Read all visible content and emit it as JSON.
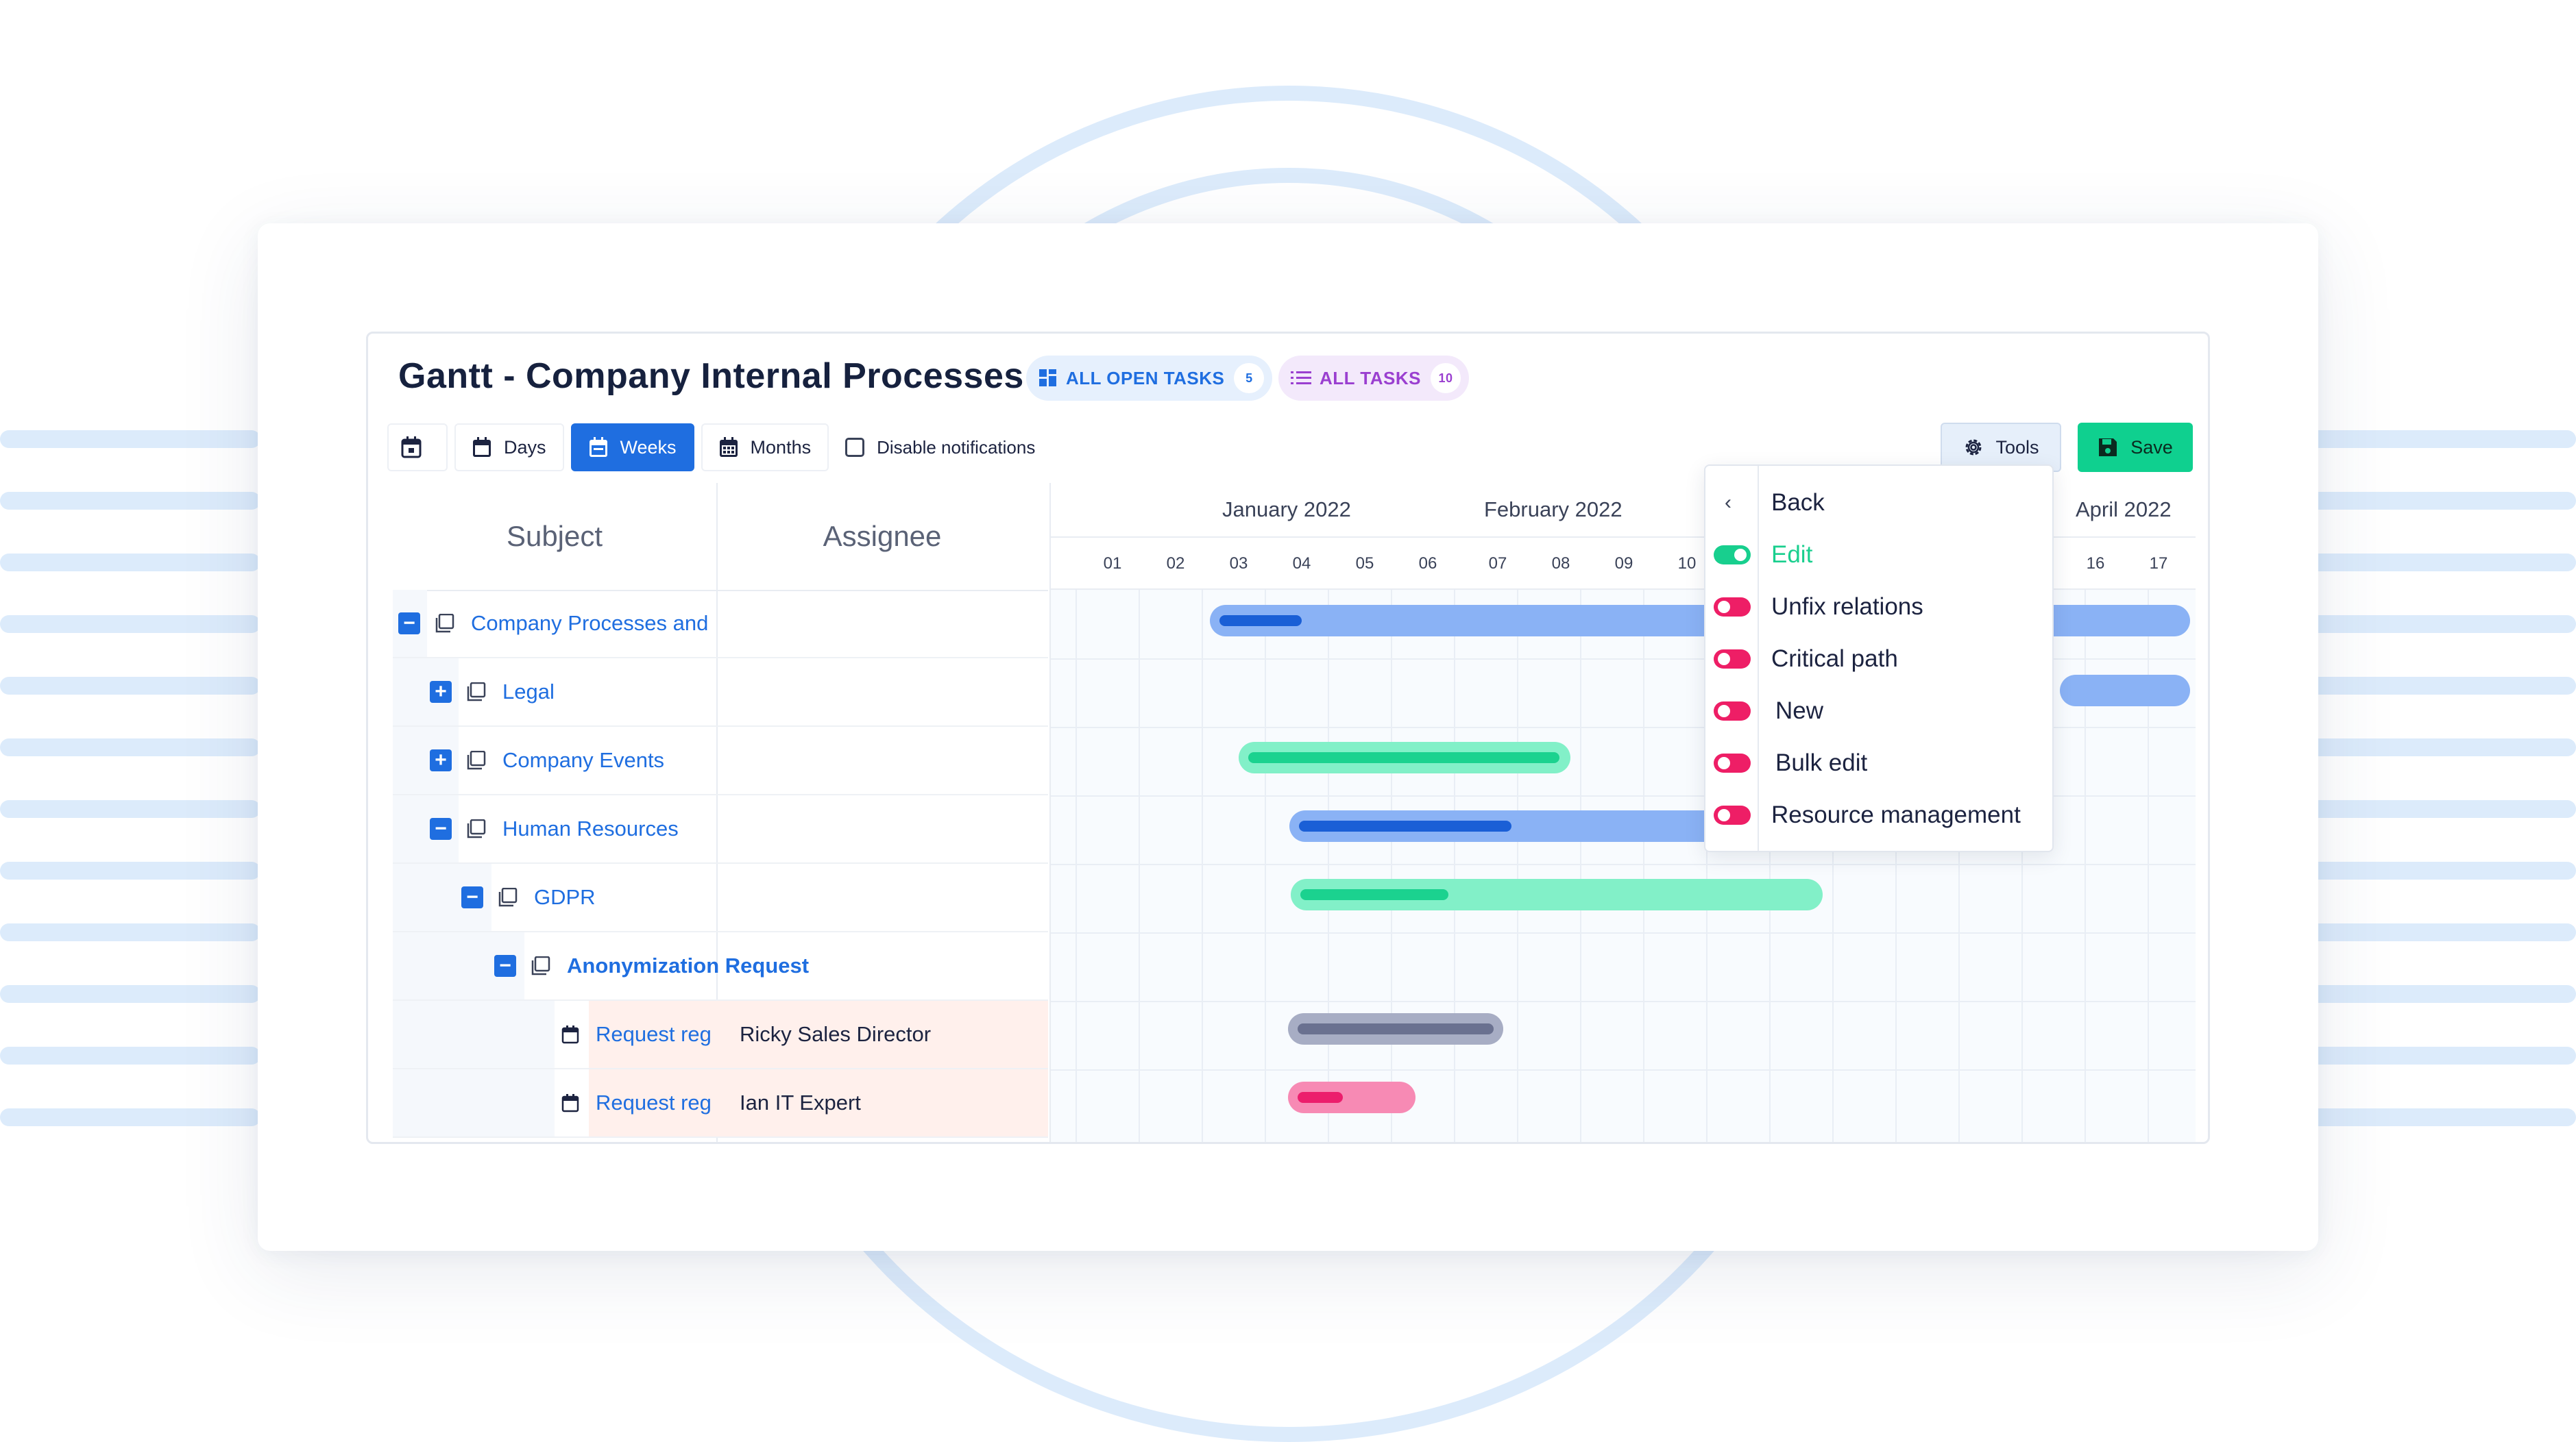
{
  "header": {
    "title": "Gantt - Company Internal Processes",
    "open_tasks_label": "ALL OPEN TASKS",
    "open_tasks_count": "5",
    "all_tasks_label": "ALL TASKS",
    "all_tasks_count": "10"
  },
  "toolbar": {
    "days_label": "Days",
    "weeks_label": "Weeks",
    "months_label": "Months",
    "disable_notifications_label": "Disable notifications",
    "tools_label": "Tools",
    "save_label": "Save"
  },
  "columns": {
    "subject": "Subject",
    "assignee": "Assignee"
  },
  "months": [
    "January 2022",
    "February 2022",
    "April 2022"
  ],
  "weeks": [
    "01",
    "02",
    "03",
    "04",
    "05",
    "06",
    "07",
    "08",
    "09",
    "10",
    "16",
    "17"
  ],
  "rows": [
    {
      "subject": "Company Processes and",
      "assignee": "",
      "toggle": "−"
    },
    {
      "subject": "Legal",
      "assignee": "",
      "toggle": "+"
    },
    {
      "subject": "Company Events",
      "assignee": "",
      "toggle": "+"
    },
    {
      "subject": "Human Resources",
      "assignee": "",
      "toggle": "−"
    },
    {
      "subject": "GDPR",
      "assignee": "",
      "toggle": "−"
    },
    {
      "subject": "Anonymization Request",
      "assignee": "",
      "toggle": "−"
    },
    {
      "subject": "Request reg",
      "assignee": "Ricky Sales Director"
    },
    {
      "subject": "Request reg",
      "assignee": "Ian IT Expert"
    }
  ],
  "tools_menu": {
    "back_label": "Back",
    "back_icon": "chevron-left-icon",
    "items": [
      {
        "label": "Edit",
        "state": "on"
      },
      {
        "label": "Unfix relations",
        "state": "off"
      },
      {
        "label": "Critical path",
        "state": "off"
      },
      {
        "label": "New",
        "state": "off"
      },
      {
        "label": "Bulk edit",
        "state": "off"
      },
      {
        "label": "Resource management",
        "state": "off"
      }
    ]
  },
  "colors": {
    "primary": "#1f6ee0",
    "save": "#0fd08f",
    "toggle_on": "#18cf8e",
    "toggle_off": "#ee1e66",
    "bar_blue": "#8ab2f5",
    "bar_green": "#82f0c8",
    "bar_gray": "#a7adc4",
    "bar_pink": "#f78ab4"
  }
}
